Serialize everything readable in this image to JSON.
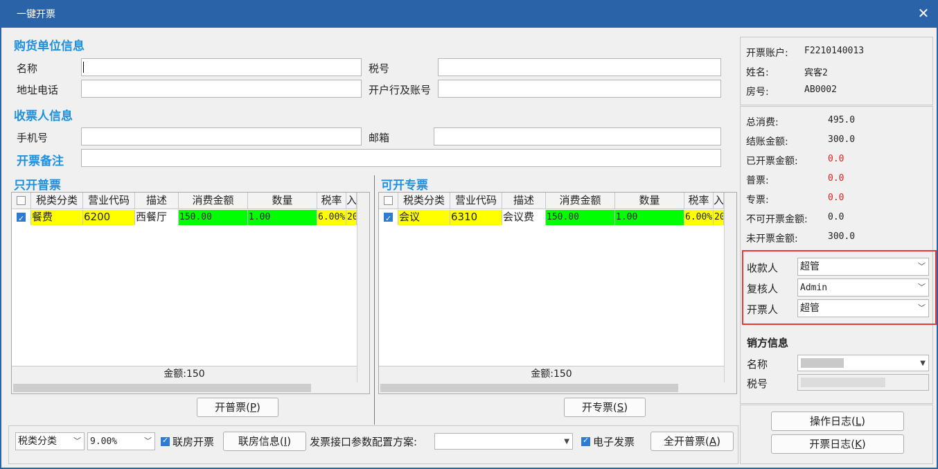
{
  "window": {
    "title": "一键开票",
    "close_glyph": "✕"
  },
  "buyer": {
    "section_title": "购货单位信息",
    "name_label": "名称",
    "name_value": "",
    "tax_label": "税号",
    "tax_value": "",
    "addr_label": "地址电话",
    "addr_value": "",
    "bank_label": "开户行及账号",
    "bank_value": ""
  },
  "receiver": {
    "section_title": "收票人信息",
    "phone_label": "手机号",
    "phone_value": "",
    "email_label": "邮箱",
    "email_value": "",
    "remark_label": "开票备注",
    "remark_value": ""
  },
  "normal_grid": {
    "title": "只开普票",
    "columns": [
      "税类分类",
      "营业代码",
      "描述",
      "消费金额",
      "数量",
      "税率",
      "入"
    ],
    "rows": [
      {
        "checked": true,
        "category": "餐费",
        "code": "6200",
        "desc": "西餐厅",
        "amount": "150.00",
        "qty": "1.00",
        "rate": "6.00%",
        "extra": "20"
      }
    ],
    "total": "金额:150",
    "button_label": "开普票(",
    "button_key": "P",
    "button_suffix": ")"
  },
  "special_grid": {
    "title": "可开专票",
    "columns": [
      "税类分类",
      "营业代码",
      "描述",
      "消费金额",
      "数量",
      "税率",
      "入"
    ],
    "rows": [
      {
        "checked": true,
        "category": "会议",
        "code": "6310",
        "desc": "会议费",
        "amount": "150.00",
        "qty": "1.00",
        "rate": "6.00%",
        "extra": "20"
      }
    ],
    "total": "金额:150",
    "button_label": "开专票(",
    "button_key": "S",
    "button_suffix": ")"
  },
  "bottom_bar": {
    "tax_category": "税类分类",
    "tax_rate": "9.00%",
    "linked_room_label": "联房开票",
    "linked_room_checked": true,
    "linked_room_info_label": "联房信息(",
    "linked_room_info_key": "I",
    "linked_room_info_suffix": ")",
    "interface_label": "发票接口参数配置方案:",
    "interface_value": "",
    "e_invoice_label": "电子发票",
    "e_invoice_checked": true,
    "all_normal_label": "全开普票(",
    "all_normal_key": "A",
    "all_normal_suffix": ")"
  },
  "account": {
    "account_label": "开票账户:",
    "account_value": "F2210140013",
    "name_label": "姓名:",
    "name_value": "宾客2",
    "room_label": "房号:",
    "room_value": "AB0002"
  },
  "summary": {
    "total_label": "总消费:",
    "total_value": "495.0",
    "checkout_label": "结账金额:",
    "checkout_value": "300.0",
    "invoiced_label": "已开票金额:",
    "invoiced_value": "0.0",
    "normal_label": "普票:",
    "normal_value": "0.0",
    "special_label": "专票:",
    "special_value": "0.0",
    "noninvoiceable_label": "不可开票金额:",
    "noninvoiceable_value": "0.0",
    "uninvoiced_label": "未开票金额:",
    "uninvoiced_value": "300.0"
  },
  "signers": {
    "payee_label": "收款人",
    "payee_value": "超管",
    "reviewer_label": "复核人",
    "reviewer_value": "Admin",
    "drawer_label": "开票人",
    "drawer_value": "超管"
  },
  "seller": {
    "section_title": "销方信息",
    "name_label": "名称",
    "tax_label": "税号"
  },
  "logs": {
    "op_log_label": "操作日志(",
    "op_log_key": "L",
    "op_log_suffix": ")",
    "invoice_log_label": "开票日志(",
    "invoice_log_key": "K",
    "invoice_log_suffix": ")"
  },
  "colors": {
    "highlight_box": "#e53935",
    "title_bar": "#2b63a8",
    "section_title": "#1e90e0",
    "red_value": "#e02020",
    "yellow_cell": "#ffff00",
    "green_cell": "#00ff00"
  }
}
